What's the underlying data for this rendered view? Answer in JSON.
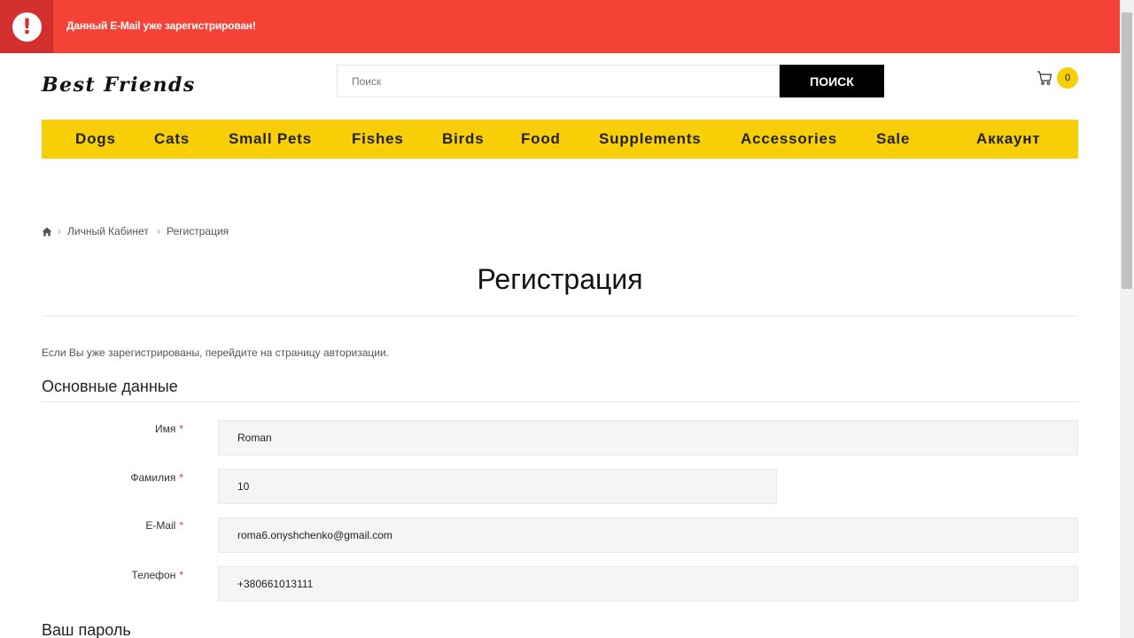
{
  "alert": {
    "icon": "exclamation-icon",
    "message": "Данный E-Mail уже зарегистрирован!",
    "color": "#f44336"
  },
  "header": {
    "logo": "Best Friends",
    "search_placeholder": "Поиск",
    "search_button": "ПОИСК",
    "cart_count": "0"
  },
  "nav": {
    "items": [
      "Dogs",
      "Cats",
      "Small Pets",
      "Fishes",
      "Birds",
      "Food",
      "Supplements",
      "Accessories",
      "Sale",
      "Аккаунт"
    ],
    "color": "#f8cf06"
  },
  "breadcrumb": {
    "items": [
      "Личный Кабинет",
      "Регистрация"
    ]
  },
  "page": {
    "title": "Регистрация",
    "intro": "Если Вы уже зарегистрированы, перейдите на страницу авторизации."
  },
  "sections": {
    "personal": "Основные данные",
    "password": "Ваш пароль"
  },
  "fields": {
    "firstname": {
      "label": "Имя",
      "value": "Roman"
    },
    "lastname": {
      "label": "Фамилия",
      "value": "10"
    },
    "email": {
      "label": "E-Mail",
      "value": "roma6.onyshchenko@gmail.com"
    },
    "phone": {
      "label": "Телефон",
      "value": "+380661013111"
    }
  },
  "required_mark": "*"
}
